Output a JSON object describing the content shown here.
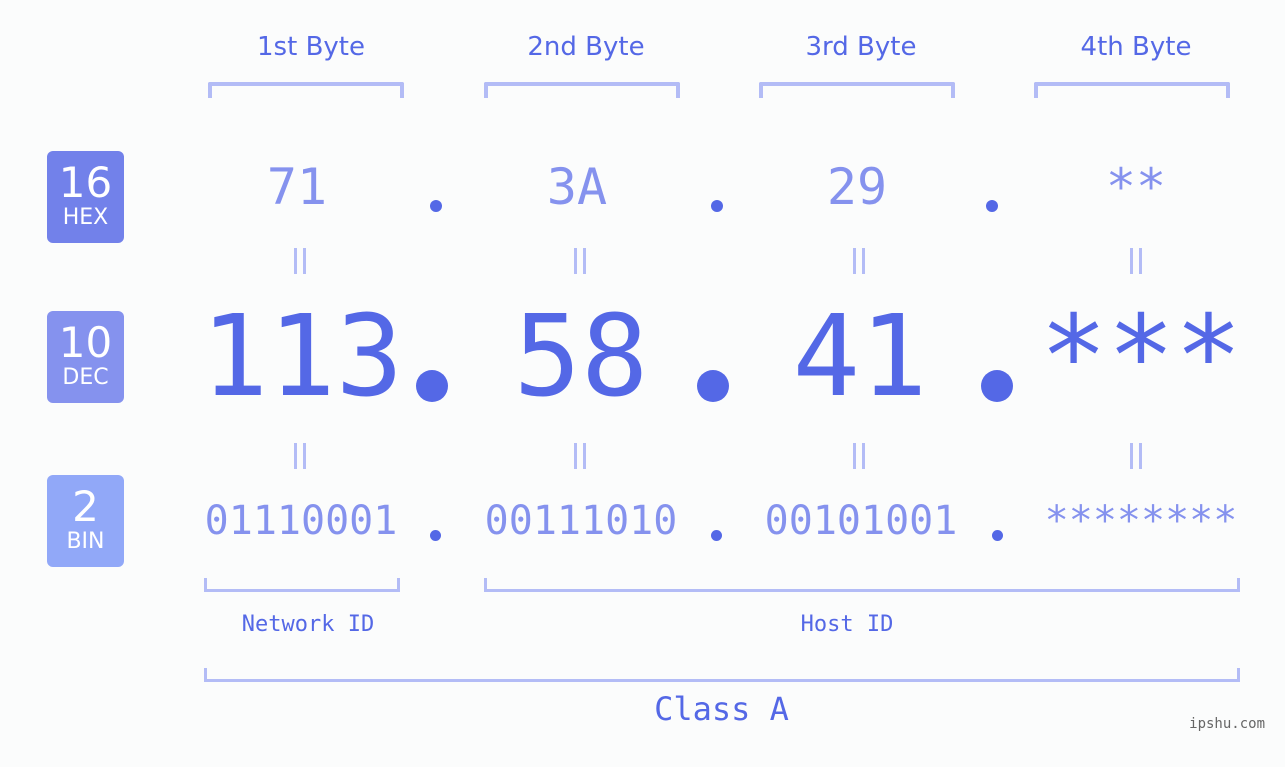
{
  "byte_headers": [
    "1st Byte",
    "2nd Byte",
    "3rd Byte",
    "4th Byte"
  ],
  "badges": [
    {
      "base": "16",
      "label": "HEX",
      "color": "#7281ea"
    },
    {
      "base": "10",
      "label": "DEC",
      "color": "#8592ee"
    },
    {
      "base": "2",
      "label": "BIN",
      "color": "#91a8f8"
    }
  ],
  "hex_values": [
    "71",
    "3A",
    "29",
    "**"
  ],
  "dec_values": [
    "113",
    "58",
    "41",
    "***"
  ],
  "bin_values": [
    "01110001",
    "00111010",
    "00101001",
    "********"
  ],
  "network_id_label": "Network ID",
  "host_id_label": "Host ID",
  "class_label": "Class A",
  "watermark": "ipshu.com",
  "colors": {
    "accent": "#5468e6",
    "muted_value": "#8592ee",
    "bracket": "#b3bcf6",
    "background": "#fbfcfc"
  }
}
